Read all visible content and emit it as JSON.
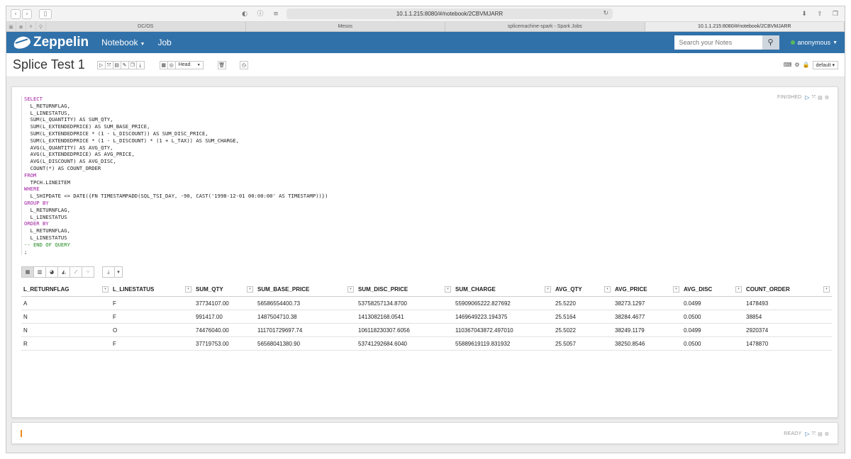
{
  "browser": {
    "url": "10.1.1.215:8080/#/notebook/2CBVMJARR",
    "tabs": [
      {
        "label": "DC/OS"
      },
      {
        "label": "Mesos"
      },
      {
        "label": "splicemachine-spark - Spark Jobs"
      },
      {
        "label": "10.1.1.215:8080/#/notebook/2CBVMJARR"
      }
    ]
  },
  "header": {
    "brand": "Zeppelin",
    "nav": [
      {
        "label": "Notebook"
      },
      {
        "label": "Job"
      }
    ],
    "search_placeholder": "Search your Notes",
    "user": "anonymous"
  },
  "notebook": {
    "title": "Splice Test 1",
    "head_select": "Head",
    "interpreter": "default"
  },
  "paragraphs": [
    {
      "status": "FINISHED",
      "code": [
        "SELECT",
        "  L_RETURNFLAG,",
        "  L_LINESTATUS,",
        "  SUM(L_QUANTITY) AS SUM_QTY,",
        "  SUM(L_EXTENDEDPRICE) AS SUM_BASE_PRICE,",
        "  SUM(L_EXTENDEDPRICE * (1 - L_DISCOUNT)) AS SUM_DISC_PRICE,",
        "  SUM(L_EXTENDEDPRICE * (1 - L_DISCOUNT) * (1 + L_TAX)) AS SUM_CHARGE,",
        "  AVG(L_QUANTITY) AS AVG_QTY,",
        "  AVG(L_EXTENDEDPRICE) AS AVG_PRICE,",
        "  AVG(L_DISCOUNT) AS AVG_DISC,",
        "  COUNT(*) AS COUNT_ORDER",
        "FROM",
        "  TPCH.LINEITEM",
        "WHERE",
        "  L_SHIPDATE <= DATE({FN TIMESTAMPADD(SQL_TSI_DAY, -90, CAST('1998-12-01 00:00:00' AS TIMESTAMP))})",
        "GROUP BY",
        "  L_RETURNFLAG,",
        "  L_LINESTATUS",
        "ORDER BY",
        "  L_RETURNFLAG,",
        "  L_LINESTATUS",
        "-- END OF QUERY",
        ";"
      ],
      "table": {
        "columns": [
          "L_RETURNFLAG",
          "L_LINESTATUS",
          "SUM_QTY",
          "SUM_BASE_PRICE",
          "SUM_DISC_PRICE",
          "SUM_CHARGE",
          "AVG_QTY",
          "AVG_PRICE",
          "AVG_DISC",
          "COUNT_ORDER"
        ],
        "rows": [
          [
            "A",
            "F",
            "37734107.00",
            "56586554400.73",
            "53758257134.8700",
            "55909065222.827692",
            "25.5220",
            "38273.1297",
            "0.0499",
            "1478493"
          ],
          [
            "N",
            "F",
            "991417.00",
            "1487504710.38",
            "1413082168.0541",
            "1469649223.194375",
            "25.5164",
            "38284.4677",
            "0.0500",
            "38854"
          ],
          [
            "N",
            "O",
            "74476040.00",
            "111701729697.74",
            "106118230307.6056",
            "110367043872.497010",
            "25.5022",
            "38249.1179",
            "0.0499",
            "2920374"
          ],
          [
            "R",
            "F",
            "37719753.00",
            "56568041380.90",
            "53741292684.6040",
            "55889619119.831932",
            "25.5057",
            "38250.8546",
            "0.0500",
            "1478870"
          ]
        ]
      }
    },
    {
      "status": "READY"
    }
  ]
}
